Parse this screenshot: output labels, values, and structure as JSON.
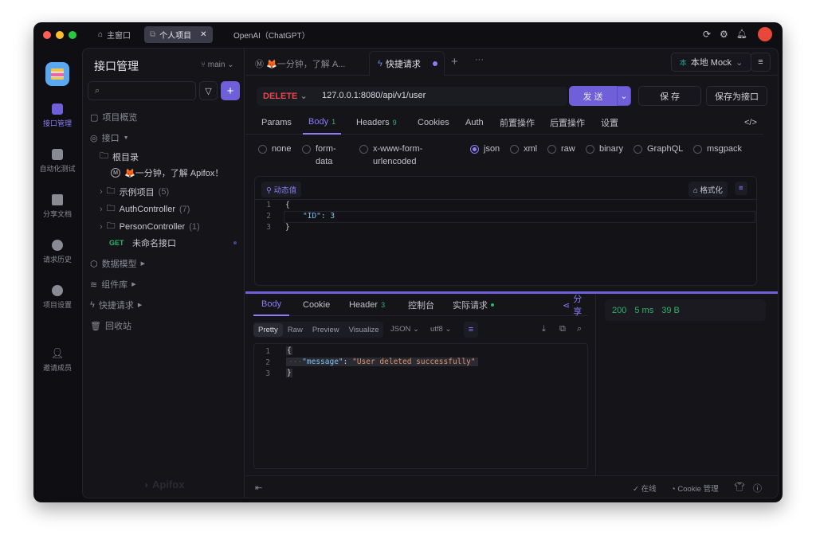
{
  "titlebar": {
    "tabs": [
      {
        "label": "主窗口",
        "icon": "home-icon"
      },
      {
        "label": "个人项目",
        "icon": "external-icon",
        "active": true
      },
      {
        "label": "OpenAI（ChatGPT）"
      }
    ],
    "icons": [
      "refresh-icon",
      "gear-icon",
      "bell-icon",
      "avatar"
    ]
  },
  "rail": {
    "items": [
      {
        "label": "接口管理",
        "active": true
      },
      {
        "label": "自动化测试"
      },
      {
        "label": "分享文档"
      },
      {
        "label": "请求历史"
      },
      {
        "label": "项目设置"
      },
      {
        "label": "邀请成员"
      }
    ]
  },
  "sidebar": {
    "title": "接口管理",
    "branch": "main",
    "search_placeholder": "",
    "items": [
      {
        "label": "项目概览"
      },
      {
        "label": "接口"
      },
      {
        "label": "根目录"
      },
      {
        "label": "🦊一分钟，了解 Apifox！"
      },
      {
        "label": "示例项目",
        "count": "(5)"
      },
      {
        "label": "AuthController",
        "count": "(7)"
      },
      {
        "label": "PersonController",
        "count": "(1)"
      },
      {
        "method": "GET",
        "label": "未命名接口"
      },
      {
        "label": "数据模型"
      },
      {
        "label": "组件库"
      },
      {
        "label": "快捷请求"
      },
      {
        "label": "回收站"
      }
    ],
    "watermark": "Apifox"
  },
  "tabs": {
    "items": [
      {
        "label": "🦊一分钟，了解 A..."
      },
      {
        "label": "快捷请求",
        "active": true
      }
    ],
    "env": "本地 Mock",
    "env_badge": "本"
  },
  "request": {
    "method": "DELETE",
    "url": "127.0.0.1:8080/api/v1/user",
    "send": "发 送",
    "save": "保 存",
    "save_as": "保存为接口"
  },
  "req_tabs": [
    {
      "label": "Params"
    },
    {
      "label": "Body",
      "count": "1",
      "active": true
    },
    {
      "label": "Headers",
      "count": "9"
    },
    {
      "label": "Cookies"
    },
    {
      "label": "Auth"
    },
    {
      "label": "前置操作"
    },
    {
      "label": "后置操作"
    },
    {
      "label": "设置"
    }
  ],
  "body_types": [
    "none",
    "form-data",
    "x-www-form-urlencoded",
    "json",
    "xml",
    "raw",
    "binary",
    "GraphQL",
    "msgpack"
  ],
  "body_type_form_data": [
    "form-",
    "data"
  ],
  "body_type_urlencoded": [
    "x-www-form-",
    "urlencoded"
  ],
  "editor": {
    "dynamic": "动态值",
    "format": "格式化",
    "lines": [
      "{",
      "\"ID\": 3",
      "}"
    ]
  },
  "response": {
    "tabs": [
      {
        "label": "Body",
        "active": true
      },
      {
        "label": "Cookie"
      },
      {
        "label": "Header",
        "count": "3"
      },
      {
        "label": "控制台"
      },
      {
        "label": "实际请求"
      }
    ],
    "share": "分享",
    "views": [
      "Pretty",
      "Raw",
      "Preview",
      "Visualize"
    ],
    "format": "JSON",
    "encoding": "utf8",
    "lines": [
      "{",
      "\"message\"",
      "\"User deleted successfully\"",
      "}"
    ],
    "status": "200",
    "time": "5 ms",
    "size": "39 B"
  },
  "footer": {
    "online": "在线",
    "cookie": "Cookie 管理"
  }
}
